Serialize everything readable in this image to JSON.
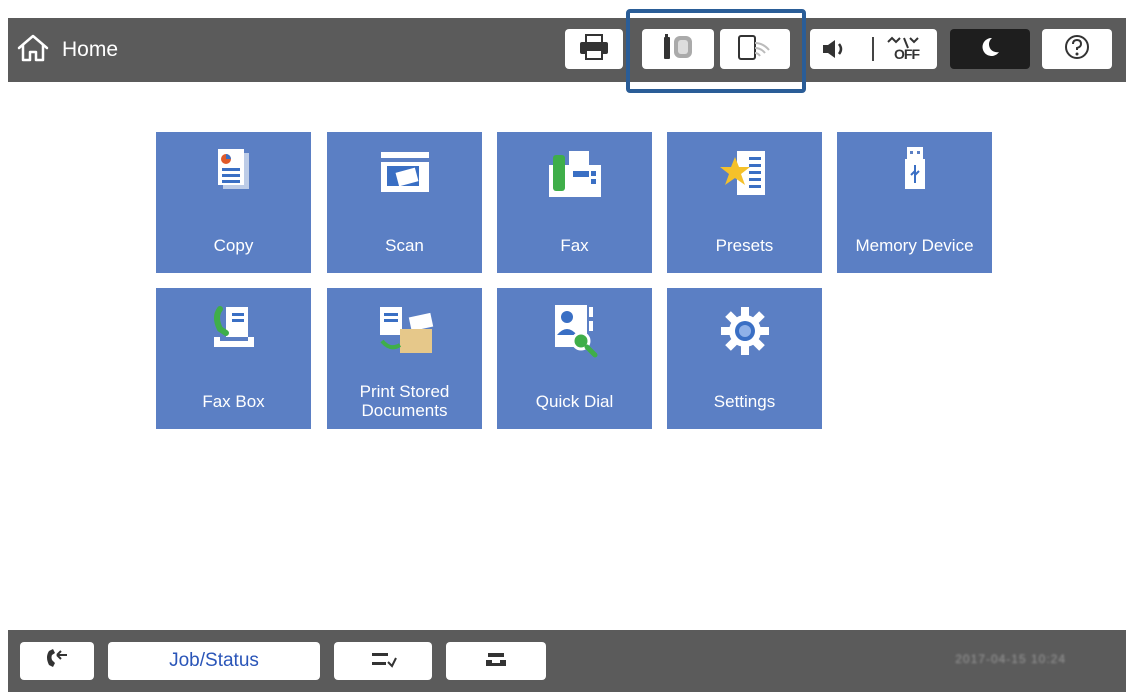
{
  "header": {
    "title": "Home",
    "icons": [
      "home-icon",
      "printer-icon",
      "nfc-icon",
      "wifi-direct-icon",
      "volume-icon",
      "quiet-mode-off-icon",
      "sleep-icon",
      "help-icon"
    ],
    "quiet_label": "OFF"
  },
  "tiles": [
    {
      "label": "Copy",
      "icon": "copy-icon"
    },
    {
      "label": "Scan",
      "icon": "scanner-icon"
    },
    {
      "label": "Fax",
      "icon": "fax-icon"
    },
    {
      "label": "Presets",
      "icon": "presets-star-icon"
    },
    {
      "label": "Memory Device",
      "icon": "usb-icon"
    },
    {
      "label": "Fax Box",
      "icon": "fax-box-icon"
    },
    {
      "label": "Print Stored Documents",
      "icon": "print-stored-documents-icon"
    },
    {
      "label": "Quick Dial",
      "icon": "quick-dial-icon"
    },
    {
      "label": "Settings",
      "icon": "gear-icon"
    }
  ],
  "bottom": {
    "job_status_label": "Job/Status",
    "datetime": "2017-04-15 10:24"
  },
  "colors": {
    "topbar": "#5b5b5b",
    "tile": "#5b7fc4",
    "highlight": "#2a5d97",
    "job_status_text": "#2a55b8"
  }
}
